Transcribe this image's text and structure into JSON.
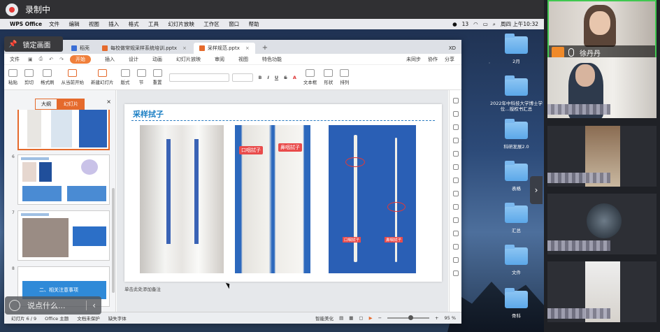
{
  "recording": {
    "label": "录制中"
  },
  "menubar": {
    "app": "WPS Office",
    "menus": [
      "文件",
      "编辑",
      "视图",
      "插入",
      "格式",
      "工具",
      "幻灯片放映",
      "工作区",
      "窗口",
      "帮助"
    ],
    "badge_count": "13",
    "clock": "周四 上午10:32"
  },
  "lock": {
    "label": "锁定画面"
  },
  "wps": {
    "tabs": [
      {
        "label": "稻壳",
        "active": false
      },
      {
        "label": "每校做常规采样系统培训.pptx",
        "active": false
      },
      {
        "label": "采样规范.pptx",
        "active": true
      }
    ],
    "user_initials": "XD",
    "ribbon_tabs": [
      "开始",
      "插入",
      "设计",
      "动画",
      "幻灯片放映",
      "审阅",
      "视图",
      "特色功能"
    ],
    "file_menu": "文件",
    "ribbon_right": [
      "未同步",
      "协作",
      "分享"
    ],
    "tools": [
      "粘贴",
      "剪切",
      "格式刷",
      "从当前开始",
      "新建幻灯片",
      "版式",
      "节",
      "重置",
      "文本框",
      "形状",
      "排列"
    ],
    "panel_tabs": [
      "大纲",
      "幻灯片"
    ],
    "slide_numbers": [
      "6",
      "7",
      "8"
    ],
    "slide8_title": "二、相关注意事项",
    "slide": {
      "title": "采样拭子",
      "label_oral": "口咽拭子",
      "label_nasal": "鼻咽拭子",
      "label_oral_small": "口咽拭子",
      "label_nasal_small": "鼻咽拭子"
    },
    "notes_placeholder": "单击此处添加备注",
    "status": {
      "slide_pos": "幻灯片 6 / 9",
      "theme": "Office 主题",
      "protect": "文档未保护",
      "missing_font": "缺失字体",
      "beautify": "智能美化",
      "zoom": "95 %"
    }
  },
  "chat": {
    "placeholder": "说点什么..."
  },
  "desktop_folders": [
    "2月",
    "2022年中科技大学博士学位…授权书汇总",
    "科研发展2.0",
    "表格",
    "汇总",
    "文件",
    "骨科"
  ],
  "participants": {
    "active_name": "徐丹丹"
  }
}
